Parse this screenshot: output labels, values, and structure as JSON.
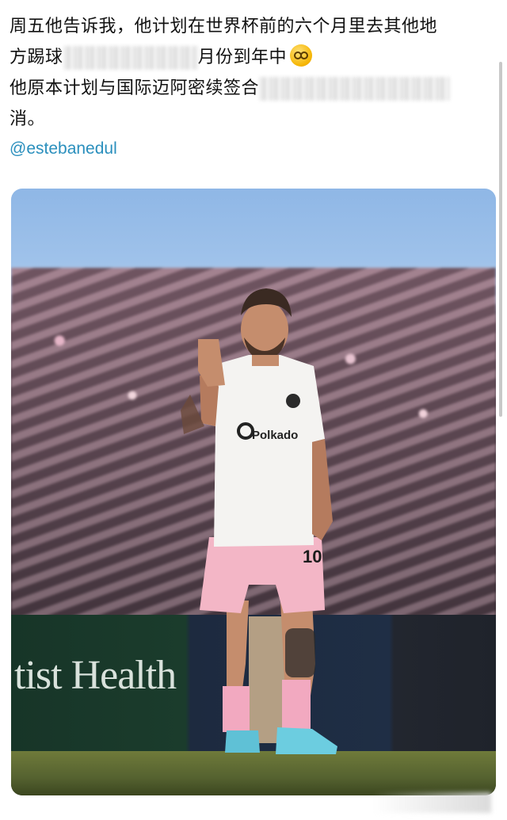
{
  "post": {
    "line1": "周五他告诉我，他计划在世界杯前的六个月里去其他地",
    "line2_start": "方踢球",
    "line2_end": "月份到年中",
    "line3": "他原本计划与国际迈阿密续签合",
    "line4": "消。"
  },
  "mention": "@estebanedul",
  "photo": {
    "sponsor_text": "tist Health",
    "shirt_sponsor": "Polkado",
    "shorts_number": "10"
  },
  "colors": {
    "link": "#2a8fbd",
    "shirt": "#f4f3f1",
    "shorts": "#f3b6c6"
  },
  "icons": {
    "emoji": "exploding-head-emoji"
  }
}
